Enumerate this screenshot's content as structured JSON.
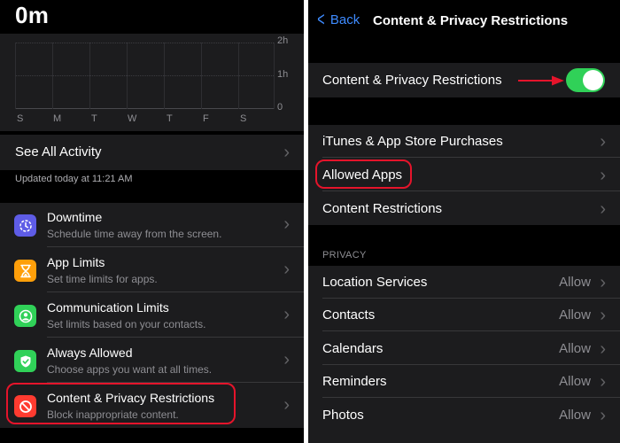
{
  "left": {
    "time_total": "0m",
    "chart": {
      "y_labels": [
        "2h",
        "1h",
        "0"
      ],
      "days": [
        "S",
        "M",
        "T",
        "W",
        "T",
        "F",
        "S"
      ]
    },
    "see_all_label": "See All Activity",
    "updated_text": "Updated today at 11:21 AM",
    "settings": [
      {
        "title": "Downtime",
        "subtitle": "Schedule time away from the screen.",
        "icon": "downtime-icon",
        "color": "#5e5ce6"
      },
      {
        "title": "App Limits",
        "subtitle": "Set time limits for apps.",
        "icon": "hourglass-icon",
        "color": "#ff9f0a"
      },
      {
        "title": "Communication Limits",
        "subtitle": "Set limits based on your contacts.",
        "icon": "person-circle-icon",
        "color": "#30d158"
      },
      {
        "title": "Always Allowed",
        "subtitle": "Choose apps you want at all times.",
        "icon": "checkmark-shield-icon",
        "color": "#30d158"
      },
      {
        "title": "Content & Privacy Restrictions",
        "subtitle": "Block inappropriate content.",
        "icon": "restriction-icon",
        "color": "#ff3b30"
      }
    ]
  },
  "right": {
    "back_label": "Back",
    "nav_title": "Content & Privacy Restrictions",
    "toggle_row": {
      "label": "Content & Privacy Restrictions",
      "state": "on",
      "color": "#30d158"
    },
    "main_items": [
      {
        "label": "iTunes & App Store Purchases"
      },
      {
        "label": "Allowed Apps"
      },
      {
        "label": "Content Restrictions"
      }
    ],
    "privacy_header": "PRIVACY",
    "privacy_items": [
      {
        "label": "Location Services",
        "value": "Allow"
      },
      {
        "label": "Contacts",
        "value": "Allow"
      },
      {
        "label": "Calendars",
        "value": "Allow"
      },
      {
        "label": "Reminders",
        "value": "Allow"
      },
      {
        "label": "Photos",
        "value": "Allow"
      }
    ]
  },
  "colors": {
    "background": "#000000",
    "card": "#1c1c1e",
    "accent": "#3e8bff",
    "highlight": "#e5142b",
    "toggle_on": "#30d158"
  }
}
